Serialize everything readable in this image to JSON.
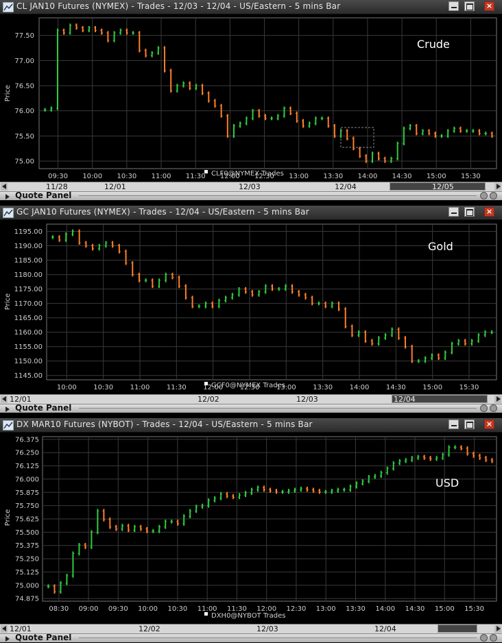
{
  "panels": [
    {
      "title": "CL JAN10 Futures (NYMEX) - Trades - 12/03 - 12/04  - US/Eastern - 5 mins Bar",
      "label": "Crude",
      "legend": "CLF0@NYMEX Trades",
      "ylabel": "Price",
      "scroll_dates": [
        "11/28",
        "12/01",
        "12/03",
        "12/04",
        "12/05"
      ],
      "quote_panel": "Quote Panel",
      "chart_data": {
        "type": "bar",
        "xlabel": "",
        "ylabel": "Price",
        "ylim": [
          74.85,
          77.85
        ],
        "y_ticks": [
          "77.50",
          "77.00",
          "76.50",
          "76.00",
          "75.50",
          "75.00"
        ],
        "y_tick_values": [
          77.5,
          77.0,
          76.5,
          76.0,
          75.5,
          75.0
        ],
        "x_ticks": [
          "09:30",
          "10:00",
          "10:30",
          "11:00",
          "11:30",
          "12:00",
          "12:30",
          "13:00",
          "13:30",
          "14:00",
          "14:30",
          "15:00",
          "15:30"
        ],
        "series": [
          {
            "name": "CLF0@NYMEX Trades",
            "values": [
              76.02,
              76.05,
              77.6,
              77.55,
              77.7,
              77.65,
              77.6,
              77.65,
              77.6,
              77.55,
              77.4,
              77.55,
              77.6,
              77.55,
              77.55,
              77.2,
              77.1,
              77.15,
              77.25,
              76.8,
              76.4,
              76.5,
              76.55,
              76.45,
              76.5,
              76.35,
              76.2,
              76.1,
              75.9,
              75.5,
              75.7,
              75.75,
              75.85,
              76.0,
              75.9,
              75.85,
              75.85,
              75.9,
              76.05,
              75.95,
              75.8,
              75.7,
              75.75,
              75.85,
              75.85,
              75.7,
              75.5,
              75.6,
              75.45,
              75.25,
              75.1,
              75.0,
              75.15,
              75.05,
              75.0,
              75.05,
              75.35,
              75.65,
              75.7,
              75.55,
              75.6,
              75.55,
              75.5,
              75.5,
              75.6,
              75.65,
              75.6,
              75.6,
              75.6,
              75.55,
              75.55,
              75.5
            ]
          }
        ]
      }
    },
    {
      "title": "GC JAN10 Futures (NYMEX) - Trades - 12/04  - US/Eastern - 5 mins Bar",
      "label": "Gold",
      "legend": "GCF0@NYMEX Trades",
      "ylabel": "Price",
      "scroll_dates": [
        "12/01",
        "12/02",
        "12/03",
        "12/04"
      ],
      "quote_panel": "Quote Panel",
      "chart_data": {
        "type": "bar",
        "xlabel": "",
        "ylabel": "Price",
        "ylim": [
          1143.5,
          1197.5
        ],
        "y_ticks": [
          "1195.00",
          "1190.00",
          "1185.00",
          "1180.00",
          "1175.00",
          "1170.00",
          "1165.00",
          "1160.00",
          "1155.00",
          "1150.00",
          "1145.00"
        ],
        "y_tick_values": [
          1195,
          1190,
          1185,
          1180,
          1175,
          1170,
          1165,
          1160,
          1155,
          1150,
          1145
        ],
        "x_ticks": [
          "10:00",
          "10:30",
          "11:00",
          "11:30",
          "12:00",
          "12:30",
          "13:00",
          "13:30",
          "14:00",
          "14:30",
          "15:00",
          "15:30"
        ],
        "series": [
          {
            "name": "GCF0@NYMEX Trades",
            "values": [
              1193,
              1192,
              1194,
              1195,
              1191,
              1190,
              1189,
              1190,
              1191,
              1190,
              1188,
              1184,
              1180,
              1178,
              1178,
              1176,
              1178,
              1180,
              1179,
              1176,
              1172,
              1169,
              1169,
              1170,
              1169,
              1171,
              1172,
              1173,
              1175,
              1174,
              1173,
              1174,
              1176,
              1175,
              1175,
              1176,
              1174,
              1173,
              1172,
              1170,
              1170,
              1169,
              1170,
              1168,
              1162,
              1159,
              1160,
              1157,
              1156,
              1158,
              1159,
              1161,
              1158,
              1155,
              1150,
              1150,
              1151,
              1152,
              1151,
              1153,
              1156,
              1157,
              1156,
              1157,
              1159,
              1160,
              1160
            ]
          }
        ]
      }
    },
    {
      "title": "DX MAR10 Futures (NYBOT) - Trades - 12/04  - US/Eastern - 5 mins Bar",
      "label": "USD",
      "legend": "DXH0@NYBOT Trades",
      "ylabel": "Price",
      "scroll_dates": [
        "12/01",
        "12/02",
        "12/03",
        "12/04"
      ],
      "quote_panel": "Quote Panel",
      "chart_data": {
        "type": "bar",
        "xlabel": "",
        "ylabel": "Price",
        "ylim": [
          74.85,
          76.4
        ],
        "y_ticks": [
          "76.375",
          "76.250",
          "76.125",
          "76.000",
          "75.875",
          "75.750",
          "75.625",
          "75.500",
          "75.375",
          "75.250",
          "75.125",
          "75.000",
          "74.875"
        ],
        "y_tick_values": [
          76.375,
          76.25,
          76.125,
          76.0,
          75.875,
          75.75,
          75.625,
          75.5,
          75.375,
          75.25,
          75.125,
          75.0,
          74.875
        ],
        "x_ticks": [
          "08:30",
          "09:00",
          "09:30",
          "10:00",
          "10:30",
          "11:00",
          "11:30",
          "12:00",
          "12:30",
          "13:00",
          "13:30",
          "14:00",
          "14:30",
          "15:00",
          "15:30"
        ],
        "series": [
          {
            "name": "DXH0@NYBOT Trades",
            "values": [
              74.99,
              74.94,
              75.02,
              75.09,
              75.3,
              75.38,
              75.36,
              75.5,
              75.7,
              75.62,
              75.55,
              75.53,
              75.56,
              75.52,
              75.55,
              75.53,
              75.51,
              75.51,
              75.55,
              75.6,
              75.6,
              75.58,
              75.65,
              75.7,
              75.74,
              75.75,
              75.8,
              75.82,
              75.86,
              75.84,
              75.83,
              75.85,
              75.87,
              75.9,
              75.92,
              75.9,
              75.89,
              75.88,
              75.88,
              75.89,
              75.9,
              75.91,
              75.9,
              75.89,
              75.88,
              75.88,
              75.89,
              75.9,
              75.9,
              75.93,
              75.96,
              75.98,
              76.02,
              76.03,
              76.06,
              76.1,
              76.15,
              76.17,
              76.18,
              76.2,
              76.21,
              76.2,
              76.19,
              76.2,
              76.23,
              76.3,
              76.3,
              76.29,
              76.24,
              76.22,
              76.2,
              76.18,
              76.17
            ]
          }
        ]
      }
    }
  ],
  "colors": {
    "up": "#2ecc40",
    "down": "#ff7f2a",
    "grid": "#3a3a3a",
    "background": "#000000",
    "frame": "#888888"
  },
  "icons": {
    "title": "chart-app-icon",
    "min": "minimize-icon",
    "max": "maximize-icon",
    "close": "close-icon"
  }
}
